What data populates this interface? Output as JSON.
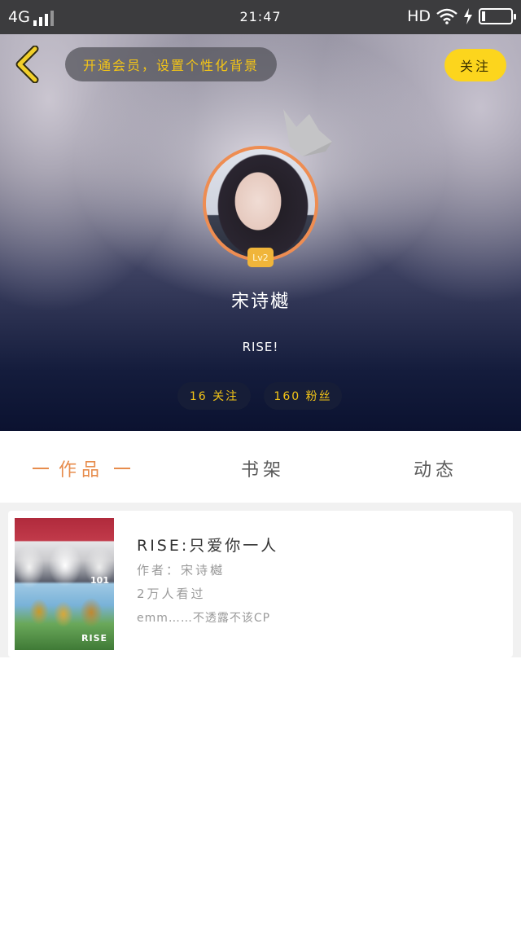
{
  "status_bar": {
    "network": "4G",
    "time": "21:47",
    "hd_label": "HD",
    "battery_level": 0.12
  },
  "header": {
    "vip_banner": "开通会员，设置个性化背景",
    "follow_label": "关注"
  },
  "profile": {
    "level_badge": "Lv2",
    "username": "宋诗樾",
    "signature": "RISE!",
    "following_stat": "16 关注",
    "fans_stat": "160 粉丝"
  },
  "tabs": {
    "works": "作品",
    "bookshelf": "书架",
    "activity": "动态"
  },
  "work": {
    "title": "RISE:只爱你一人",
    "author": "作者：宋诗樾",
    "views": "2万人看过",
    "summary": "emm……不透露不该CP",
    "cover_tag": "101",
    "cover_label": "RISE"
  },
  "colors": {
    "accent_orange": "#e78c4c",
    "vip_yellow": "#f4c516",
    "follow_button": "#fcd51d"
  }
}
